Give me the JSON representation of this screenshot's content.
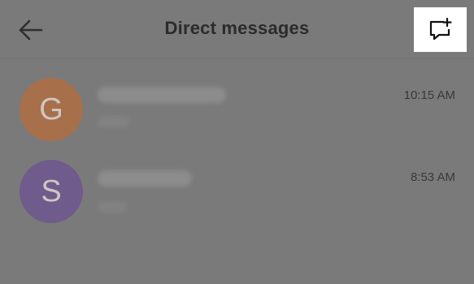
{
  "header": {
    "title": "Direct messages",
    "back_icon": "arrow-left-icon",
    "compose_icon": "new-message-icon"
  },
  "conversations": [
    {
      "avatar_letter": "G",
      "avatar_color": "#a7704b",
      "name": "",
      "preview": "",
      "time": "10:15 AM"
    },
    {
      "avatar_letter": "S",
      "avatar_color": "#6f5b8c",
      "name": "",
      "preview": "",
      "time": "8:53 AM"
    }
  ],
  "colors": {
    "overlay_background": "#7a7a7a",
    "compose_highlight": "#ffffff"
  }
}
